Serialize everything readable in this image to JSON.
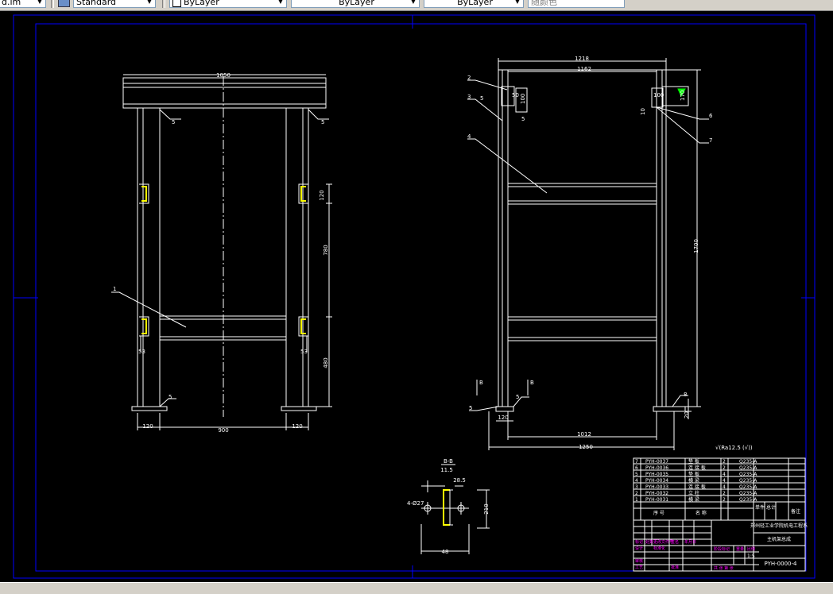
{
  "toolbar": {
    "layer_partial": "d.im",
    "text_style": "Standard",
    "layer": "ByLayer",
    "linetype": "ByLayer",
    "lineweight": "ByLayer",
    "plot_style": "随颜色"
  },
  "drawing": {
    "left_view": {
      "dim_top_width": "1050",
      "dim_weld_left": "5",
      "dim_weld_right": "5",
      "dim_clip_height": "120",
      "dim_middle": "780",
      "dim_lower": "480",
      "dim_bracket_left": "53",
      "dim_bracket_right": "53",
      "dim_foot_left": "120",
      "dim_span": "900",
      "dim_foot_right": "120",
      "dim_weld_bottom": "5",
      "callout_1": "1"
    },
    "right_view": {
      "dim_top_outer": "1218",
      "dim_top_inner": "1162",
      "dim_clip_left_w": "50",
      "dim_clip_left_h": "100",
      "dim_clip_right_w": "100",
      "dim_clip_right_h": "170",
      "dim_small": "10",
      "dim_height": "1700",
      "dim_bottom_inner": "1012",
      "dim_bottom_outer": "1250",
      "dim_foot": "120",
      "dim_foot_right": "20",
      "dim_right_weld": "8",
      "dim_weld_bl": "5",
      "weld_note_1": "5",
      "weld_note_2": "5",
      "callout_2": "2",
      "callout_3": "3",
      "callout_4": "4",
      "callout_5": "5",
      "callout_6": "6",
      "callout_7": "7",
      "section_mark_1": "B",
      "section_mark_2": "B"
    },
    "section": {
      "title": "B-B",
      "dim_top": "11.5",
      "dim_flange": "28.5",
      "dim_hole": "4-Ø27",
      "dim_height": "210",
      "dim_width": "48"
    },
    "roughness_note": "√(Ra12.5 (√))"
  },
  "title_block": {
    "bom_rows": [
      {
        "no": "7",
        "code": "PYH-0037",
        "name": "垫 板",
        "qty": "2",
        "mat": "Q235-A"
      },
      {
        "no": "6",
        "code": "PYH-0036",
        "name": "连 接 板",
        "qty": "2",
        "mat": "Q235-A"
      },
      {
        "no": "5",
        "code": "PYH-0035",
        "name": "垫 板",
        "qty": "4",
        "mat": "Q235-A"
      },
      {
        "no": "4",
        "code": "PYH-0034",
        "name": "横 梁",
        "qty": "4",
        "mat": "Q235-A"
      },
      {
        "no": "3",
        "code": "PYH-0033",
        "name": "连 接 板",
        "qty": "4",
        "mat": "Q235-A"
      },
      {
        "no": "2",
        "code": "PYH-0032",
        "name": "立 柱",
        "qty": "2",
        "mat": "Q235-A"
      },
      {
        "no": "1",
        "code": "PYH-0031",
        "name": "横 梁",
        "qty": "2",
        "mat": "Q235-A"
      }
    ],
    "header_no": "序 号",
    "header_name": "名 称",
    "header_note": "备注",
    "header_unit": "单件",
    "header_total": "总计",
    "company": "郑州轻工业学院机电工程系",
    "drawing_name": "主机架总成",
    "drawing_no": "PYH-0000-4",
    "scale": "1:5",
    "labels": [
      "标记",
      "处数",
      "更改文件号",
      "签名",
      "年月日",
      "设计",
      "审核",
      "工艺",
      "标准化",
      "批准",
      "阶段标记",
      "重量",
      "比例",
      "共 张 第 张"
    ]
  },
  "colors": {
    "cad_bg": "#000000",
    "line": "#ffffff",
    "frame": "#0000ff",
    "yellow": "#ffff00",
    "green": "#00ff00",
    "magenta": "#ff00ff",
    "cyan": "#00ffff"
  },
  "icons": [
    "layer-icon",
    "text-style-icon",
    "color-icon"
  ]
}
